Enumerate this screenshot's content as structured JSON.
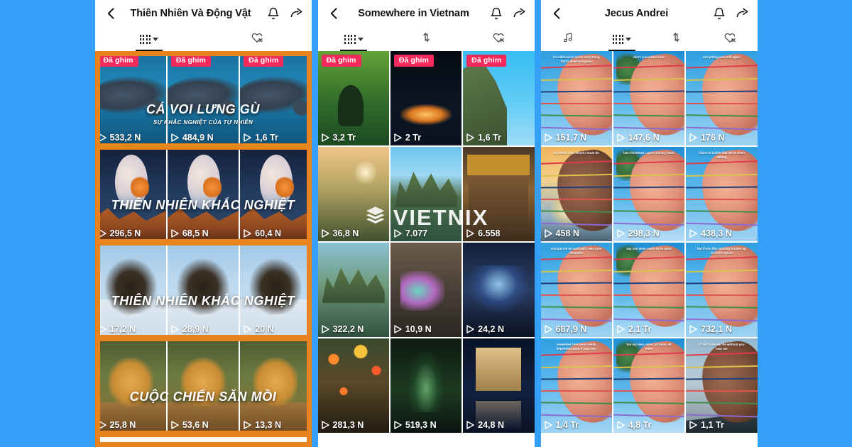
{
  "background_color": "#35a0f7",
  "accent_orange": "#e8841b",
  "badge_color": "#f5295b",
  "panels": [
    {
      "id": "panel-nature",
      "header": {
        "back_icon": "chevron-left-icon",
        "title": "Thiên Nhiên Và Động Vật",
        "bell_icon": "bell-icon",
        "share_icon": "share-arrow-icon"
      },
      "tabs": [
        {
          "icon": "grid-columns-icon",
          "caret": true,
          "active": true
        },
        {
          "icon": "heart-off-icon",
          "caret": false,
          "active": false
        }
      ],
      "framed": true,
      "rows": [
        {
          "title": "CÁ VOI LƯNG GÙ",
          "subtitle": "SỰ KHẮC NGHIỆT CỦA TỰ NHIÊN",
          "cells": [
            {
              "badge": "Đã ghim",
              "views": "533,2 N",
              "art": "whale"
            },
            {
              "badge": "Đã ghim",
              "views": "484,9 N",
              "art": "whale"
            },
            {
              "badge": "Đã ghim",
              "views": "1,6 Tr",
              "art": "whale"
            }
          ]
        },
        {
          "title": "THIÊN NHIÊN KHẮC NGHIỆT",
          "subtitle": "",
          "cells": [
            {
              "badge": "",
              "views": "296,5 N",
              "art": "night"
            },
            {
              "badge": "",
              "views": "68,5 N",
              "art": "night"
            },
            {
              "badge": "",
              "views": "60,4 N",
              "art": "night"
            }
          ]
        },
        {
          "title": "THIÊN NHIÊN KHẮC NGHIỆT",
          "subtitle": "",
          "cells": [
            {
              "badge": "",
              "views": "17,2 N",
              "art": "eagle"
            },
            {
              "badge": "",
              "views": "28,9 N",
              "art": "eagle"
            },
            {
              "badge": "",
              "views": "20 N",
              "art": "eagle"
            }
          ]
        },
        {
          "title": "CUỘC CHIẾN SĂN MỒI",
          "subtitle": "",
          "cells": [
            {
              "badge": "",
              "views": "25,8 N",
              "art": "cheetah"
            },
            {
              "badge": "",
              "views": "53,6 N",
              "art": "cheetah"
            },
            {
              "badge": "",
              "views": "13,3 N",
              "art": "cheetah"
            }
          ]
        }
      ]
    },
    {
      "id": "panel-vietnam",
      "header": {
        "back_icon": "chevron-left-icon",
        "title": "Somewhere in Vietnam",
        "bell_icon": "bell-icon",
        "share_icon": "share-arrow-icon"
      },
      "tabs": [
        {
          "icon": "grid-columns-icon",
          "caret": true,
          "active": true
        },
        {
          "icon": "sort-arrows-icon",
          "caret": false,
          "active": false
        },
        {
          "icon": "heart-off-icon",
          "caret": false,
          "active": false
        }
      ],
      "framed": false,
      "watermark": {
        "text": "VIETNIX",
        "icon": "stacked-layers-icon"
      },
      "rows": [
        {
          "title": "",
          "subtitle": "",
          "cells": [
            {
              "badge": "Đã ghim",
              "views": "3,2 Tr",
              "art": "jungle"
            },
            {
              "badge": "Đã ghim",
              "views": "2 Tr",
              "art": "boat"
            },
            {
              "badge": "Đã ghim",
              "views": "1,6 Tr",
              "art": "karst"
            }
          ]
        },
        {
          "title": "",
          "subtitle": "",
          "cells": [
            {
              "badge": "",
              "views": "36,8 N",
              "art": "valley"
            },
            {
              "badge": "",
              "views": "7.077",
              "art": "river"
            },
            {
              "badge": "",
              "views": "6.558",
              "art": "temple"
            }
          ]
        },
        {
          "title": "",
          "subtitle": "",
          "cells": [
            {
              "badge": "",
              "views": "322,2 N",
              "art": "lagoon"
            },
            {
              "badge": "",
              "views": "10,9 N",
              "art": "grotto"
            },
            {
              "badge": "",
              "views": "24,2 N",
              "art": "stage"
            }
          ]
        },
        {
          "title": "",
          "subtitle": "",
          "cells": [
            {
              "badge": "",
              "views": "281,3 N",
              "art": "lantern"
            },
            {
              "badge": "",
              "views": "519,3 N",
              "art": "greenlight"
            },
            {
              "badge": "",
              "views": "24,8 N",
              "art": "pagoda"
            }
          ]
        }
      ]
    },
    {
      "id": "panel-jecus",
      "header": {
        "back_icon": "chevron-left-icon",
        "title": "Jecus Andrei",
        "bell_icon": "bell-icon",
        "share_icon": "share-arrow-icon"
      },
      "tabs": [
        {
          "icon": "music-note-icon",
          "caret": false,
          "active": false
        },
        {
          "icon": "grid-columns-icon",
          "caret": true,
          "active": true
        },
        {
          "icon": "sort-arrows-icon",
          "caret": false,
          "active": false
        },
        {
          "icon": "heart-off-icon",
          "caret": false,
          "active": false
        }
      ],
      "framed": false,
      "rows": [
        {
          "title": "",
          "subtitle": "",
          "cells": [
            {
              "badge": "",
              "views": "151,7 N",
              "art": "hand1",
              "caption": "i'm still leavin' quick everything that's dead and gone"
            },
            {
              "badge": "",
              "views": "147,6 N",
              "art": "hand2",
              "caption": "don't you notice how"
            },
            {
              "badge": "",
              "views": "176 N",
              "art": "hand1",
              "caption": "everything was still again"
            }
          ]
        },
        {
          "title": "",
          "subtitle": "",
          "cells": [
            {
              "badge": "",
              "views": "458 N",
              "art": "hand3",
              "caption": "so, when i die, which i must do"
            },
            {
              "badge": "",
              "views": "298,3 N",
              "art": "hand2",
              "caption": "last christmas i gave you my heart"
            },
            {
              "badge": "",
              "views": "438,3 N",
              "art": "hand1",
              "caption": "i have to tackle that we've been talking"
            }
          ]
        },
        {
          "title": "",
          "subtitle": "",
          "cells": [
            {
              "badge": "",
              "views": "687,9 N",
              "art": "hand1",
              "caption": "you put me on and said i was your favourite"
            },
            {
              "badge": "",
              "views": "2,1 Tr",
              "art": "hand2",
              "caption": "say you were made to be mine"
            },
            {
              "badge": "",
              "views": "732,1 N",
              "art": "hand1",
              "caption": "but if you like causing trouble up in hotel rooms"
            }
          ]
        },
        {
          "title": "",
          "subtitle": "",
          "cells": [
            {
              "badge": "",
              "views": "1,4 Tr",
              "art": "hand1",
              "caption": "remember that years death dependent bout it your eye"
            },
            {
              "badge": "",
              "views": "4,8 Tr",
              "art": "hand2",
              "caption": "but my love, mine, all mine, all mine"
            },
            {
              "badge": "",
              "views": "1,1 Tr",
              "art": "hand4",
              "caption": "it had to be my life without you near me"
            }
          ]
        }
      ]
    }
  ]
}
